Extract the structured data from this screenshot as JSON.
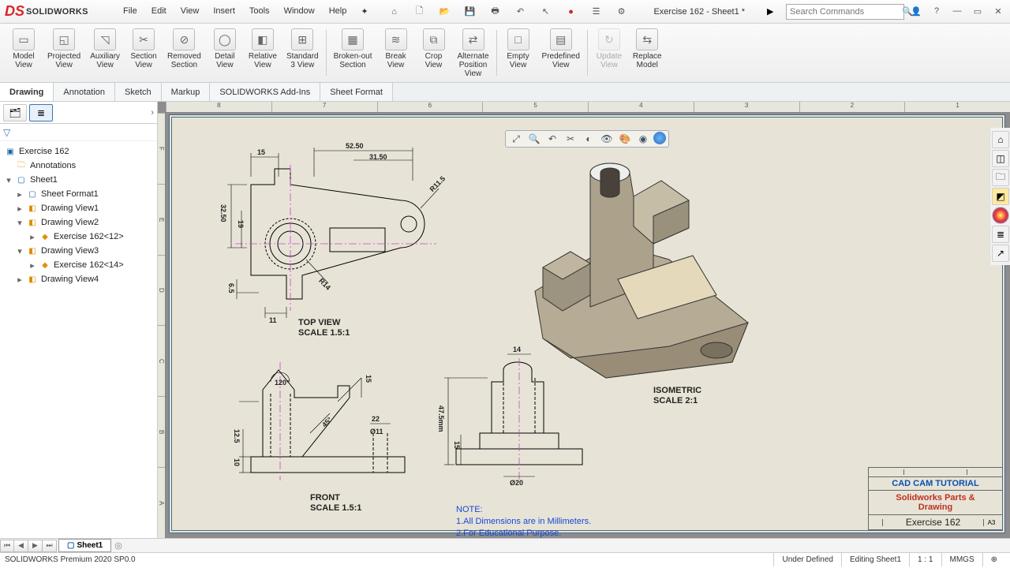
{
  "app": {
    "logo": "SOLIDWORKS",
    "doc_title": "Exercise 162 - Sheet1 *"
  },
  "menus": [
    "File",
    "Edit",
    "View",
    "Insert",
    "Tools",
    "Window",
    "Help"
  ],
  "search": {
    "placeholder": "Search Commands"
  },
  "ribbon": [
    {
      "label": "Model\nView",
      "icon": "▭"
    },
    {
      "label": "Projected\nView",
      "icon": "◱"
    },
    {
      "label": "Auxiliary\nView",
      "icon": "◹"
    },
    {
      "label": "Section\nView",
      "icon": "✂"
    },
    {
      "label": "Removed\nSection",
      "icon": "⊘"
    },
    {
      "label": "Detail\nView",
      "icon": "◯"
    },
    {
      "label": "Relative\nView",
      "icon": "◧"
    },
    {
      "label": "Standard\n3 View",
      "icon": "⊞"
    },
    {
      "label": "Broken-out\nSection",
      "icon": "▦"
    },
    {
      "label": "Break\nView",
      "icon": "≋"
    },
    {
      "label": "Crop\nView",
      "icon": "⧉"
    },
    {
      "label": "Alternate\nPosition\nView",
      "icon": "⇄"
    },
    {
      "label": "Empty\nView",
      "icon": "□"
    },
    {
      "label": "Predefined\nView",
      "icon": "▤"
    },
    {
      "label": "Update\nView",
      "icon": "↻",
      "disabled": true
    },
    {
      "label": "Replace\nModel",
      "icon": "⇆"
    }
  ],
  "ribbon_tabs": [
    {
      "label": "Drawing",
      "active": true
    },
    {
      "label": "Annotation"
    },
    {
      "label": "Sketch"
    },
    {
      "label": "Markup"
    },
    {
      "label": "SOLIDWORKS Add-Ins"
    },
    {
      "label": "Sheet Format"
    }
  ],
  "tree": {
    "root": "Exercise 162",
    "annotations": "Annotations",
    "sheet": "Sheet1",
    "sheet_format": "Sheet Format1",
    "view1": "Drawing View1",
    "view2": "Drawing View2",
    "view2_child": "Exercise 162<12>",
    "view3": "Drawing View3",
    "view3_child": "Exercise 162<14>",
    "view4": "Drawing View4"
  },
  "ruler_h": [
    "8",
    "7",
    "6",
    "5",
    "4",
    "3",
    "2",
    "1"
  ],
  "ruler_v": [
    "F",
    "E",
    "D",
    "C",
    "B",
    "A"
  ],
  "labels": {
    "top": "TOP VIEW\nSCALE 1.5:1",
    "front": "FRONT\nSCALE 1.5:1",
    "iso": "ISOMETRIC\nSCALE 2:1"
  },
  "dims": {
    "d15": "15",
    "d5250": "52.50",
    "d3150": "31.50",
    "d3250": "32.50",
    "d19": "19",
    "r115": "R11.5",
    "r14": "R14",
    "d65": "6.5",
    "d11": "11",
    "d120": "120°",
    "d45": "45°",
    "d22": "22",
    "dphi11": "Ø11",
    "d125": "12.5",
    "d10": "10",
    "d15b": "15",
    "d14": "14",
    "d475": "47.5mm",
    "d15c": "15",
    "dphi20": "Ø20"
  },
  "note": {
    "title": "NOTE:",
    "l1": "1.All Dimensions are in Millimeters.",
    "l2": "2.For Educational Purpose."
  },
  "title_block": {
    "head": "CAD CAM TUTORIAL",
    "line1": "Solidworks Parts &",
    "line2": "Drawing",
    "exercise": "Exercise 162",
    "size": "A3"
  },
  "sheet_tab": "Sheet1",
  "status": {
    "product": "SOLIDWORKS Premium 2020 SP0.0",
    "defined": "Under Defined",
    "editing": "Editing Sheet1",
    "scale": "1 : 1",
    "units": "MMGS"
  }
}
